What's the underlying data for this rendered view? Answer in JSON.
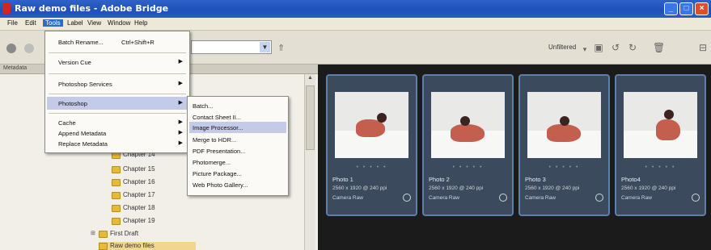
{
  "window": {
    "title": "Raw demo files - Adobe Bridge"
  },
  "menubar": [
    "File",
    "Edit",
    "Tools",
    "Label",
    "View",
    "Window",
    "Help"
  ],
  "tools_menu": {
    "batch_rename": "Batch Rename...",
    "batch_rename_shortcut": "Ctrl+Shift+R",
    "version_cue": "Version Cue",
    "photoshop_services": "Photoshop Services",
    "photoshop": "Photoshop",
    "cache": "Cache",
    "append_metadata": "Append Metadata",
    "replace_metadata": "Replace Metadata"
  },
  "photoshop_submenu": [
    "Batch...",
    "Contact Sheet II...",
    "Image Processor...",
    "Merge to HDR...",
    "PDF Presentation...",
    "Photomerge...",
    "Picture Package...",
    "Web Photo Gallery..."
  ],
  "toolbar": {
    "sort_label": "Unfiltered"
  },
  "left_panel": {
    "tab": "Metadata"
  },
  "tree": [
    {
      "label": "Chapter 14"
    },
    {
      "label": "Chapter 15"
    },
    {
      "label": "Chapter 16"
    },
    {
      "label": "Chapter 17"
    },
    {
      "label": "Chapter 18"
    },
    {
      "label": "Chapter 19"
    },
    {
      "label": "First Draft"
    },
    {
      "label": "Raw demo files"
    }
  ],
  "thumbnails": [
    {
      "name": "Photo 1",
      "dims": "2560 x 1920 @ 240 ppi",
      "type": "Camera Raw"
    },
    {
      "name": "Photo 2",
      "dims": "2560 x 1920 @ 240 ppi",
      "type": "Camera Raw"
    },
    {
      "name": "Photo 3",
      "dims": "2560 x 1920 @ 240 ppi",
      "type": "Camera Raw"
    },
    {
      "name": "Photo4",
      "dims": "2560 x 1920 @ 240 ppi",
      "type": "Camera Raw"
    }
  ]
}
